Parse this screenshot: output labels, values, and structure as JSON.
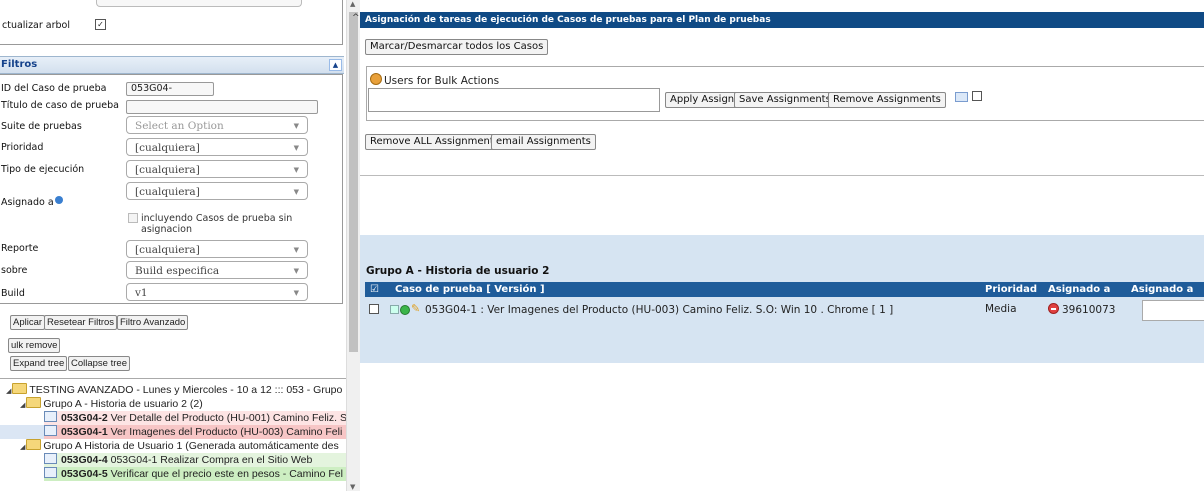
{
  "left_panel": {
    "settings": {
      "update_tree_label": "ctualizar arbol"
    },
    "filters": {
      "title": "Filtros",
      "collapse_glyph": "▲",
      "fields": {
        "test_case_id": {
          "label": "ID del Caso de prueba",
          "value": "053G04-"
        },
        "test_case_title": {
          "label": "Título de caso de prueba",
          "value": ""
        },
        "test_suite": {
          "label": "Suite de pruebas",
          "value": "Select an Option"
        },
        "priority": {
          "label": "Prioridad",
          "value": "[cualquiera]"
        },
        "execution_type": {
          "label": "Tipo de ejecución",
          "value": "[cualquiera]"
        },
        "assigned_to": {
          "label": "Asignado a",
          "value": "[cualquiera]",
          "include_unassigned_label": "incluyendo Casos de prueba sin asignacion"
        },
        "report": {
          "label": "Reporte",
          "value": "[cualquiera]"
        },
        "on": {
          "label": "sobre",
          "value": "Build especifica"
        },
        "build": {
          "label": "Build",
          "value": "v1"
        }
      },
      "buttons": {
        "apply": "Aplicar",
        "reset": "Resetear Filtros",
        "advanced": "Filtro Avanzado"
      }
    },
    "bulk_remove_label": "ulk remove",
    "expand_tree_label": "Expand tree",
    "collapse_tree_label": "Collapse tree",
    "tree": {
      "root": "TESTING AVANZADO - Lunes y Miercoles - 10 a 12 ::: 053 - Grupo",
      "group_a": "Grupo A - Historia de usuario 2 (2)",
      "items_a": [
        {
          "id": "053G04-2",
          "title": "Ver Detalle del Producto (HU-001) Camino Feliz. S",
          "color": "#fde4e4"
        },
        {
          "id": "053G04-1",
          "title": "Ver Imagenes del Producto (HU-003) Camino Feli",
          "color": "#f7c6c6"
        }
      ],
      "group_b": "Grupo A Historia de Usuario 1 (Generada automáticamente des",
      "items_b": [
        {
          "id": "053G04-4",
          "title": "053G04-1 Realizar Compra en el Sitio Web",
          "color": "#e4f4de"
        },
        {
          "id": "053G04-5",
          "title": "Verificar que el precio este en pesos - Camino Fel",
          "color": "#cdeec2"
        }
      ]
    }
  },
  "right_panel": {
    "title": "Asignación de tareas de ejecución de Casos de pruebas para el Plan de pruebas",
    "toggle_all_button": "Marcar/Desmarcar todos los Casos",
    "bulk": {
      "legend": "Users for Bulk Actions",
      "apply_assign": "Apply Assign",
      "save_assignments": "Save Assignments",
      "remove_assignments": "Remove Assignments"
    },
    "remove_all_button": "Remove ALL Assignments",
    "email_button": "email Assignments",
    "group_title": "Grupo A - Historia de usuario 2",
    "table": {
      "columns": {
        "test_case": "Caso de prueba [ Versión ]",
        "priority": "Prioridad",
        "assigned_to": "Asignado a",
        "assign_to": "Asignado a"
      },
      "rows": [
        {
          "test_case": "053G04-1 : Ver Imagenes del Producto (HU-003) Camino Feliz. S.O: Win 10 . Chrome  [ 1 ]",
          "priority": "Media",
          "assigned_to": "39610073"
        }
      ]
    }
  }
}
